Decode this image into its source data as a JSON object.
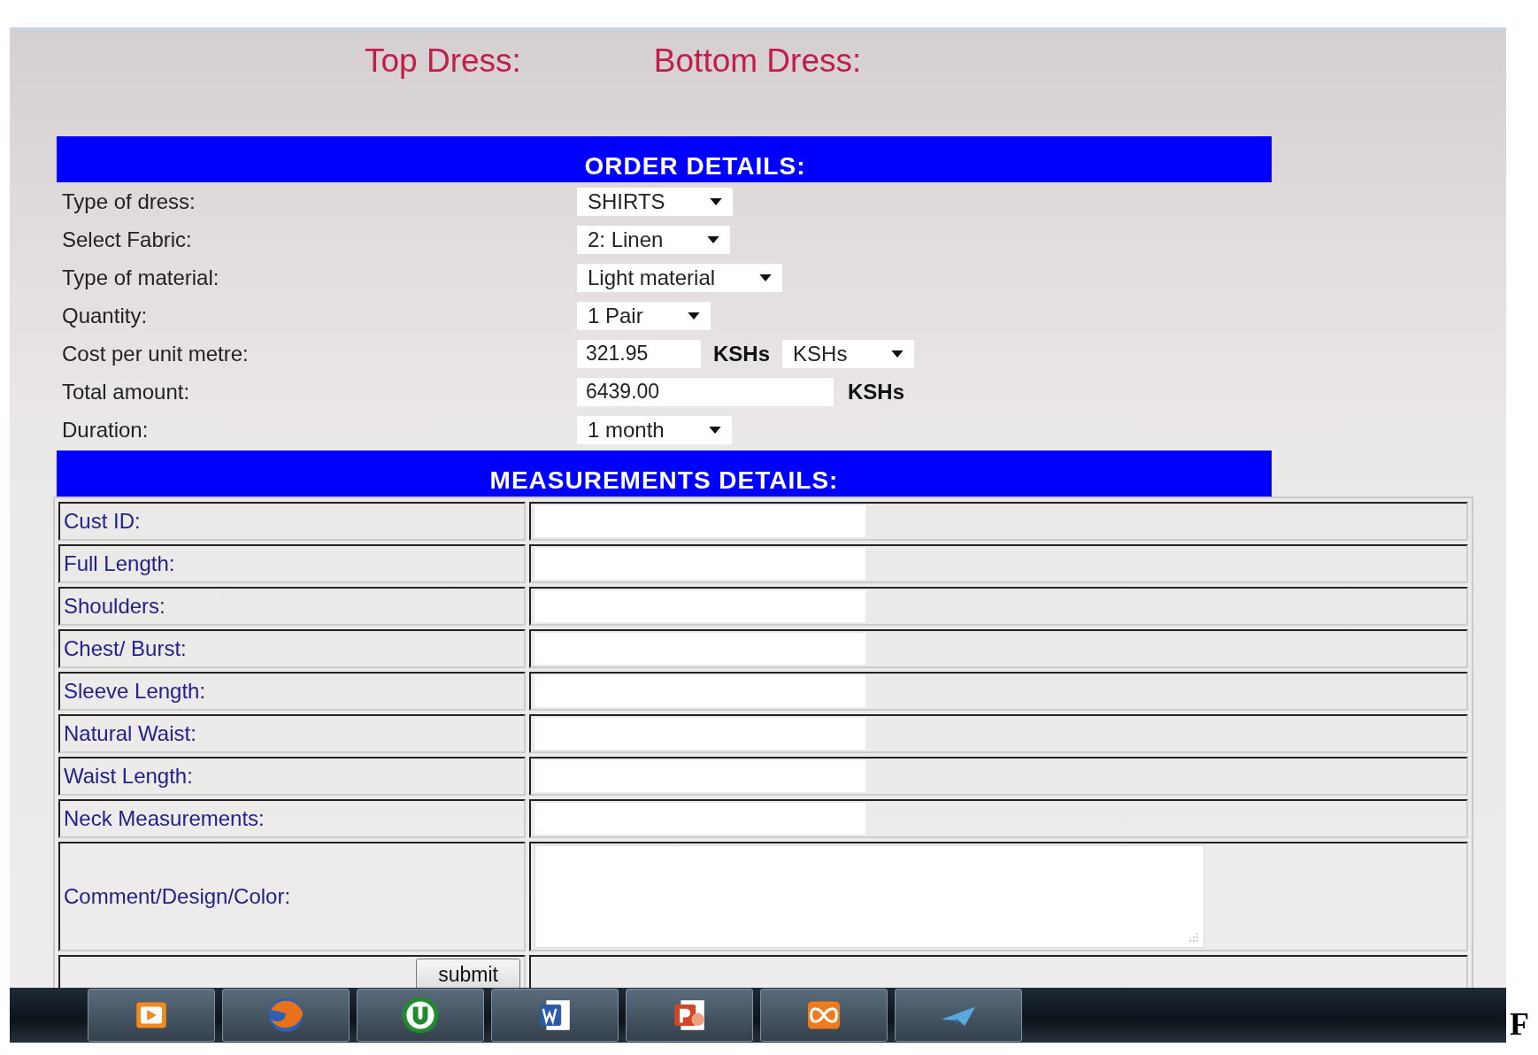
{
  "header": {
    "labels": [
      "Top Dress:",
      "Bottom Dress:"
    ]
  },
  "order": {
    "title": "ORDER DETAILS:",
    "fields": [
      {
        "label": "Type of dress:",
        "kind": "select",
        "value": "SHIRTS"
      },
      {
        "label": "Select Fabric:",
        "kind": "select",
        "value": "2: Linen"
      },
      {
        "label": "Type of material:",
        "kind": "select",
        "value": "Light material"
      },
      {
        "label": "Quantity:",
        "kind": "select",
        "value": "1 Pair"
      },
      {
        "label": "Cost per unit metre:",
        "kind": "price",
        "value": "321.95",
        "unit": "KSHs",
        "currency": "KSHs"
      },
      {
        "label": "Total amount:",
        "kind": "total",
        "value": "6439.00",
        "unit": "KSHs"
      },
      {
        "label": "Duration:",
        "kind": "select",
        "value": "1 month"
      }
    ]
  },
  "measurements": {
    "title": "MEASUREMENTS DETAILS:",
    "rows": [
      {
        "label": "Cust ID:",
        "kind": "input"
      },
      {
        "label": "Full Length:",
        "kind": "input"
      },
      {
        "label": "Shoulders:",
        "kind": "input"
      },
      {
        "label": "Chest/ Burst:",
        "kind": "input"
      },
      {
        "label": "Sleeve Length:",
        "kind": "input"
      },
      {
        "label": "Natural Waist:",
        "kind": "input"
      },
      {
        "label": "Waist Length:",
        "kind": "input"
      },
      {
        "label": "Neck Measurements:",
        "kind": "input"
      },
      {
        "label": "Comment/Design/Color:",
        "kind": "textarea"
      }
    ],
    "submit": "submit"
  },
  "taskbar": {
    "apps": [
      {
        "kind": "player"
      },
      {
        "kind": "browser"
      },
      {
        "kind": "torrent"
      },
      {
        "kind": "word"
      },
      {
        "kind": "slides"
      },
      {
        "kind": "server"
      },
      {
        "kind": "plane"
      }
    ]
  },
  "page_text": "F"
}
